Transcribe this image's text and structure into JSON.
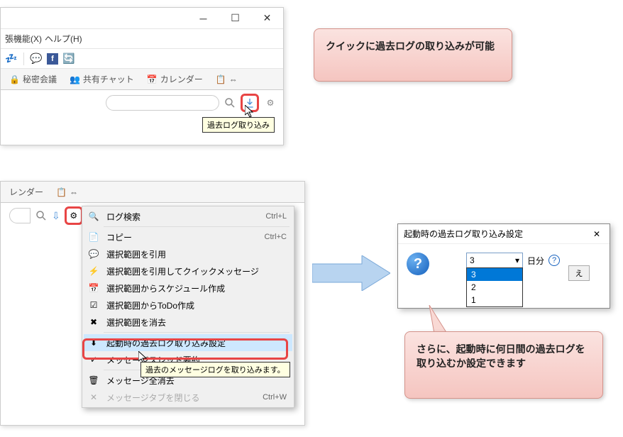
{
  "win1": {
    "menu_ext": "張機能(X)",
    "menu_help": "ヘルプ(H)",
    "tab_secret": "秘密会議",
    "tab_shared": "共有チャット",
    "tab_calendar": "カレンダー",
    "tooltip_import": "過去ログ取り込み"
  },
  "callout1": "クイックに過去ログの取り込みが可能",
  "win2": {
    "tab_calendar": "レンダー"
  },
  "menu": {
    "log_search": "ログ検索",
    "log_search_sc": "Ctrl+L",
    "copy": "コピー",
    "copy_sc": "Ctrl+C",
    "quote": "選択範囲を引用",
    "quote_quick": "選択範囲を引用してクイックメッセージ",
    "schedule": "選択範囲からスケジュール作成",
    "todo": "選択範囲からToDo作成",
    "erase": "選択範囲を消去",
    "startup_import": "起動時の過去ログ取り込み設定",
    "thread_summary": "メッセージスレッド要約",
    "delete_all": "メッセージ全消去",
    "close_tab": "メッセージタブを閉じる",
    "close_tab_sc": "Ctrl+W",
    "tooltip": "過去のメッセージログを取り込みます。"
  },
  "dialog": {
    "title": "起動時の過去ログ取り込み設定",
    "selected": "3",
    "opt1": "3",
    "opt2": "2",
    "opt3": "1",
    "days": "日分",
    "ok_partial": "え"
  },
  "callout2": "さらに、起動時に何日間の過去ログを取り込むか設定できます"
}
